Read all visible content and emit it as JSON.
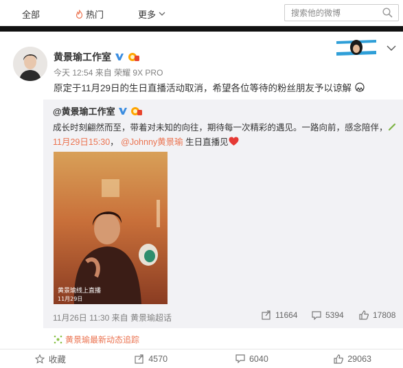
{
  "nav": {
    "tab_all": "全部",
    "tab_hot": "热门",
    "tab_more": "更多",
    "search_placeholder": "搜索他的微博"
  },
  "post": {
    "author": "黄景瑜工作室",
    "time": "今天 12:54",
    "source_prefix": "来自",
    "source": "荣耀 9X PRO",
    "text": "原定于11月29日的生日直播活动取消，希望各位等待的粉丝朋友予以谅解"
  },
  "repost": {
    "author": "@黄景瑜工作室",
    "text_before_link": "成长时刻翩然而至，带着对未知的向往，期待每一次精彩的遇见。一路向前，感念陪伴，",
    "link_text": "11月29日15:30",
    "mention": "@Johnny黄景瑜",
    "text_after": "生日直播见",
    "poster_text_line1": "黄景瑜线上直播",
    "poster_text_line2": "11月29日",
    "time": "11月26日 11:30",
    "source_prefix": "来自",
    "source": "黄景瑜超话",
    "forward_count": "11664",
    "comment_count": "5394",
    "like_count": "17808"
  },
  "track_label": "黄景瑜最新动态追踪",
  "actions": {
    "favorite": "收藏",
    "forward": "4570",
    "comment": "6040",
    "like": "29063"
  },
  "colors": {
    "accent": "#eb7350",
    "vip_badge": "#ffa500"
  }
}
